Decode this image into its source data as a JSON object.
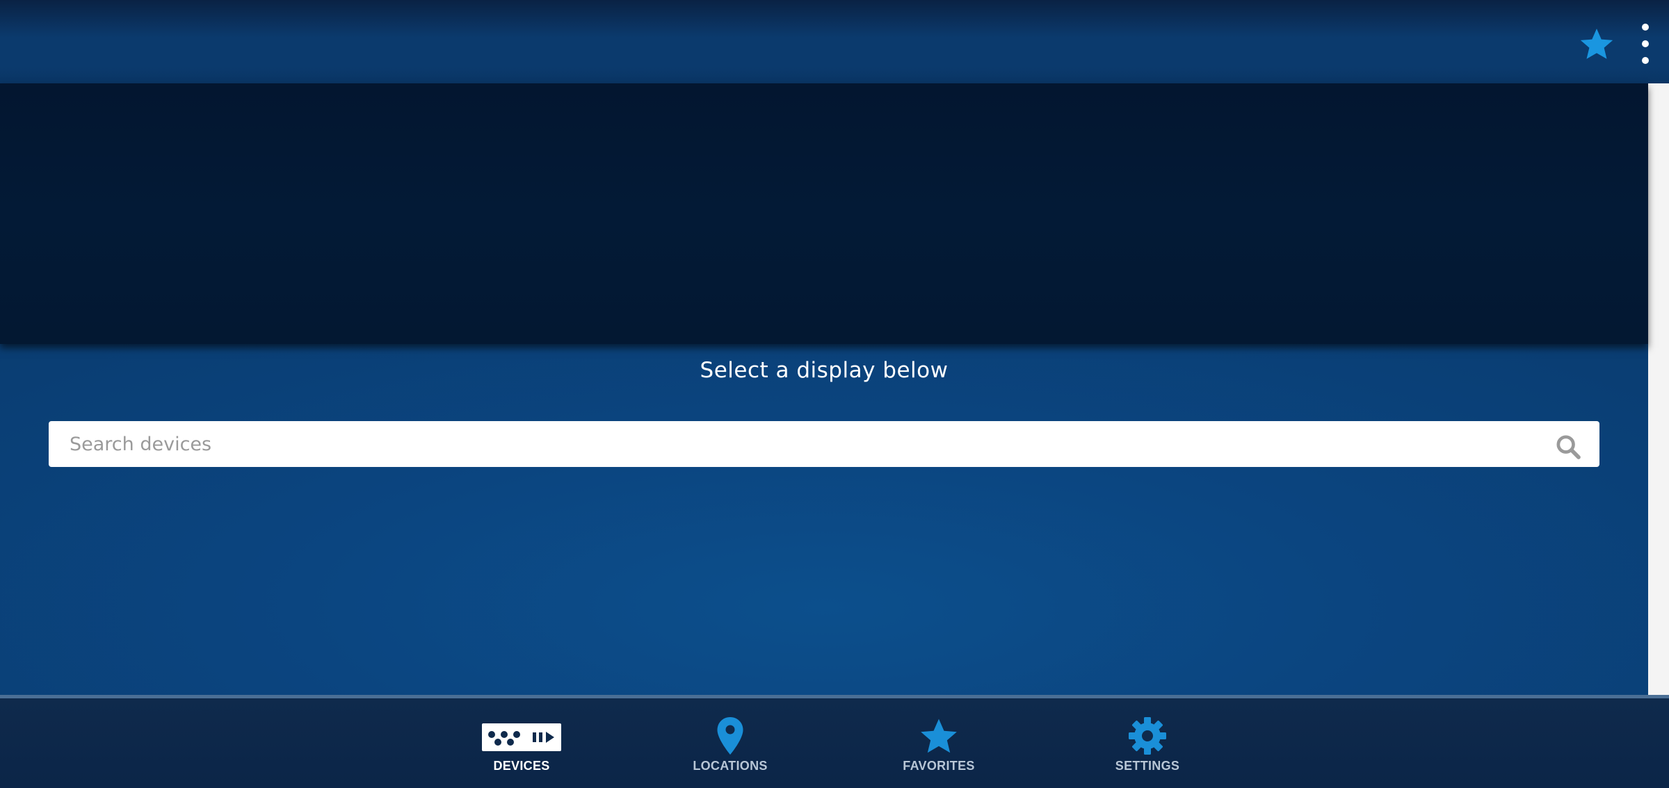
{
  "header": {
    "favorite_icon": "star-icon",
    "menu_icon": "more-vertical-icon"
  },
  "main": {
    "prompt": "Select a display below",
    "search": {
      "placeholder": "Search devices",
      "value": "",
      "icon": "search-icon"
    }
  },
  "bottom_nav": {
    "items": [
      {
        "label": "DEVICES",
        "icon": "devices-icon",
        "active": true
      },
      {
        "label": "LOCATIONS",
        "icon": "location-pin-icon",
        "active": false
      },
      {
        "label": "FAVORITES",
        "icon": "star-icon",
        "active": false
      },
      {
        "label": "SETTINGS",
        "icon": "gear-icon",
        "active": false
      }
    ]
  },
  "colors": {
    "accent": "#1a96e0",
    "header_bg": "#0b3a6d",
    "dark_panel": "#031a36",
    "active_label": "#ffffff",
    "inactive_label": "#b8c6d6"
  }
}
